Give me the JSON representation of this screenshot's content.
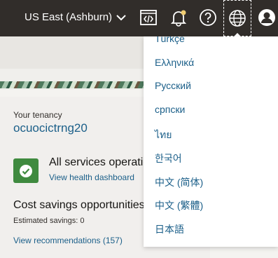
{
  "header": {
    "region_label": "US East (Ashburn)",
    "icons": [
      "code-editor-icon",
      "notifications-icon",
      "help-icon",
      "language-globe-icon",
      "profile-icon"
    ],
    "notification_dot_color": "#f0cc71"
  },
  "tenancy": {
    "label": "Your tenancy",
    "name": "ocuocictrng20"
  },
  "services": {
    "title": "All services operational",
    "link": "View health dashboard",
    "status_color": "#3f8a3f"
  },
  "cost": {
    "title": "Cost savings opportunities",
    "estimated": "Estimated savings: 0",
    "link": "View recommendations (157)"
  },
  "language_menu": {
    "items": [
      "Türkçe",
      "Ελληνικά",
      "Русский",
      "српски",
      "ไทย",
      "한국어",
      "中文 (简体)",
      "中文 (繁體)",
      "日本語"
    ]
  },
  "colors": {
    "topbar": "#312d2a",
    "link": "#1b5f89"
  }
}
